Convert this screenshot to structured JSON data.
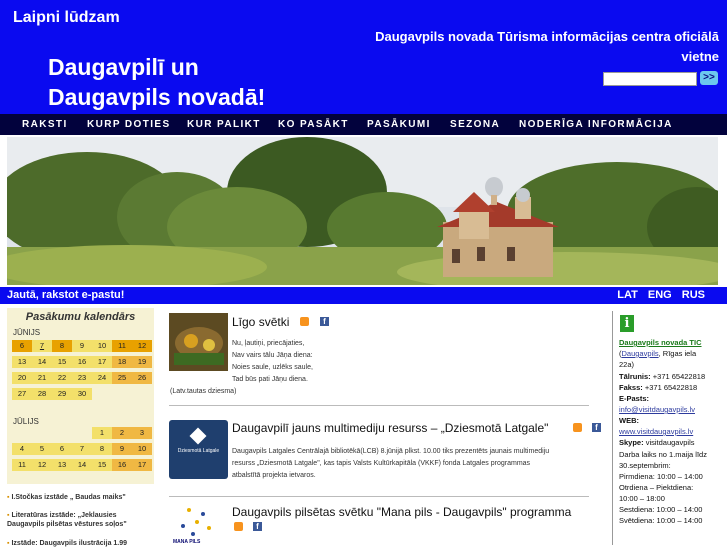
{
  "header": {
    "welcome": "Laipni lūdzam",
    "title_line1": "Daugavpilī un",
    "title_line2": "Daugavpils novadā!",
    "subtitle": "Daugavpils novada Tūrisma informācijas centra oficiālā vietne",
    "search_placeholder": "",
    "search_button": ">>"
  },
  "nav": [
    "RAKSTI",
    "KURP DOTIES",
    "KUR PALIKT",
    "KO PASĀKT",
    "PASĀKUMI",
    "SEZONA",
    "NODERĪGA INFORMĀCIJA"
  ],
  "bar": {
    "email_link": "Jautā, rakstot e-pastu!",
    "langs": [
      "LAT",
      "ENG",
      "RUS"
    ]
  },
  "calendar": {
    "title": "Pasākumu kalendārs",
    "june_label": "JŪNIJS",
    "july_label": "JŪLIJS",
    "june_rows": [
      [
        "6",
        "7",
        "8",
        "9",
        "10",
        "11",
        "12"
      ],
      [
        "13",
        "14",
        "15",
        "16",
        "17",
        "18",
        "19"
      ],
      [
        "20",
        "21",
        "22",
        "23",
        "24",
        "25",
        "26"
      ],
      [
        "27",
        "28",
        "29",
        "30",
        "",
        "",
        ""
      ]
    ],
    "july_rows": [
      [
        "",
        "",
        "",
        "",
        "1",
        "2",
        "3"
      ],
      [
        "4",
        "5",
        "6",
        "7",
        "8",
        "9",
        "10"
      ],
      [
        "11",
        "12",
        "13",
        "14",
        "15",
        "16",
        "17"
      ]
    ]
  },
  "events": [
    "I.Stočkas izstāde „ Baudas maiks\"",
    "Literatūras izstāde: „Jeklausies Daugavpils pilsētas vēstures soļos\"",
    "Izstāde: Daugavpils ilustrācija 1.99"
  ],
  "posts": [
    {
      "title": "Līgo svētki",
      "lines": [
        "Nu, ļautiņi, priecājaties,",
        "Nav vairs tālu Jāņa diena:",
        "Noies saule, uzlēks saule,",
        "Tad būs pati Jāņu diena.",
        "(Latv.tautas dziesma)"
      ]
    },
    {
      "title": "Daugavpilī jauns multimediju resurss – „Dziesmotā Latgale\"",
      "lines": [
        "Daugavpils Latgales Centrālajā bibliotēkā(LCB) 8.jūnijā plkst. 10.00 tiks prezentēts jaunais multimediju",
        "resurss „Dziesmotā Latgale\", kas tapis Valsts Kultūrkapitāla (VKKF) fonda Latgales programmas",
        "atbalstītā projekta ietvaros."
      ],
      "thumb_text": "Dziesmotā Latgale"
    },
    {
      "title": "Daugavpils pilsētas svētku \"Mana pils - Daugavpils\" programma",
      "thumb_text": "MANA PILS"
    }
  ],
  "info": {
    "icon": "i",
    "org": "Daugavpils novada TIC",
    "addr_link": "Daugavpils",
    "addr_rest": ", Rīgas iela",
    "addr_num": "22a)",
    "phone_label": "Tālrunis:",
    "phone": "+371 65422818",
    "fax_label": "Fakss:",
    "fax": "+371 65422818",
    "email_label": "E-Pasts:",
    "email": "info@visitdaugavpils.lv",
    "web_label": "WEB:",
    "web": "www.visitdaugavpils.lv",
    "skype_label": "Skype:",
    "skype": "visitdaugavpils",
    "hours_intro": "Darba laiks no 1.maija līdz 30.septembrim:",
    "wd_label": "Pirmdiena:",
    "wd_hours": "10:00 – 14:00",
    "tf_label": "Otrdiena – Piektdiena:",
    "tf_hours": "10:00 – 18:00",
    "sat_label": "Sestdiena:",
    "sat_hours": "10:00 – 14:00",
    "sun_label": "Svētdiena:",
    "sun_hours": "10:00 – 14:00"
  },
  "colors": {
    "header_blue": "#0a0af0",
    "nav_dark": "#02023d",
    "calendar_bg": "#f6f2d4",
    "day_orange": "#e8a100"
  }
}
